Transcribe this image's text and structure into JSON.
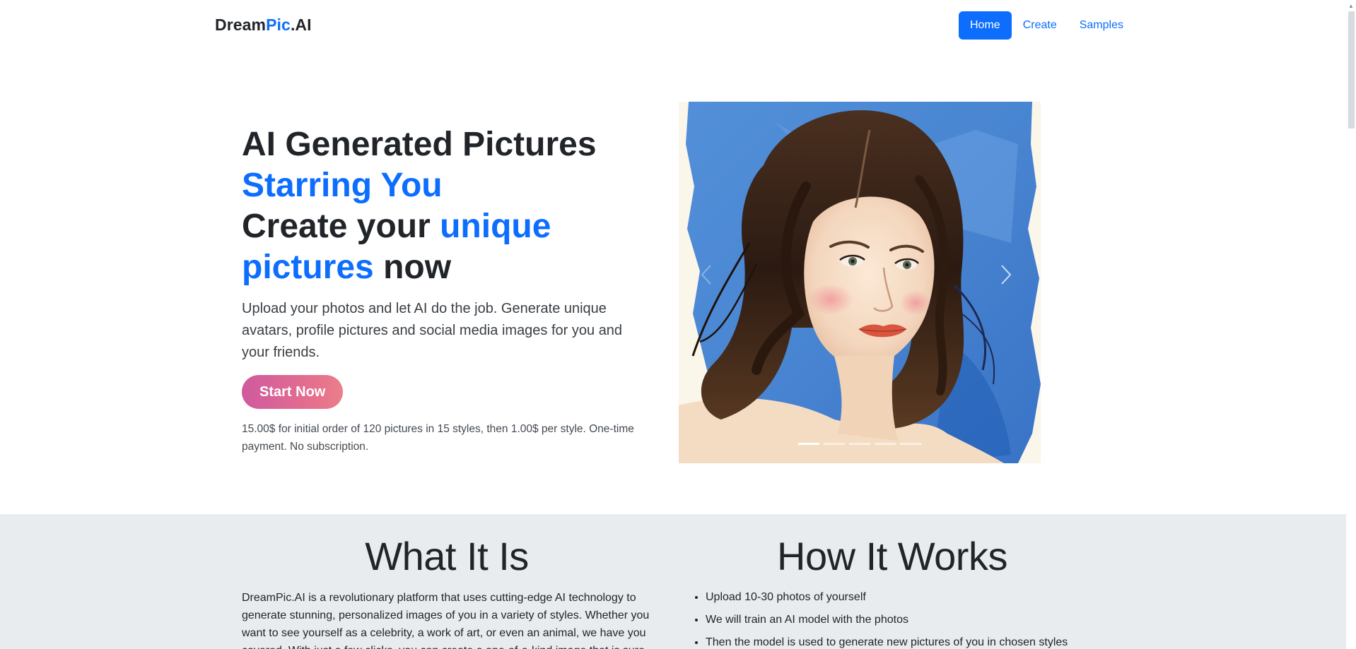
{
  "navbar": {
    "brand": {
      "part1": "Dream",
      "part2": "Pic",
      "part3": ".AI"
    },
    "links": [
      {
        "label": "Home",
        "active": true
      },
      {
        "label": "Create",
        "active": false
      },
      {
        "label": "Samples",
        "active": false
      }
    ]
  },
  "hero": {
    "title": {
      "line1": "AI Generated Pictures",
      "line2": "Starring You",
      "line3a": "Create your ",
      "line3b": "unique",
      "line4a": "pictures",
      "line4b": " now"
    },
    "lead": "Upload your photos and let AI do the job. Generate unique avatars, profile pictures and social media images for you and your friends.",
    "cta_label": "Start Now",
    "price_note": "15.00$ for initial order of 120 pictures in 15 styles, then 1.00$ per style. One-time payment. No subscription."
  },
  "carousel": {
    "image_alt": "Watercolor portrait of a woman with dark wavy hair on blue background",
    "slide_count": 5,
    "active_index": 0,
    "prev_icon": "chevron-left-icon",
    "next_icon": "chevron-right-icon"
  },
  "what_it_is": {
    "title": "What It Is",
    "body": "DreamPic.AI is a revolutionary platform that uses cutting-edge AI technology to generate stunning, personalized images of you in a variety of styles. Whether you want to see yourself as a celebrity, a work of art, or even an animal, we have you covered. With just a few clicks, you can create a one-of-a-kind image that is sure to"
  },
  "how_it_works": {
    "title": "How It Works",
    "steps": [
      "Upload 10-30 photos of yourself",
      "We will train an AI model with the photos",
      "Then the model is used to generate new pictures of you in chosen styles"
    ]
  },
  "colors": {
    "primary": "#0d6efd",
    "text": "#212529",
    "section_bg": "#e9ecef",
    "cta_gradient_start": "#cf5a9e",
    "cta_gradient_end": "#ea7f8a"
  }
}
